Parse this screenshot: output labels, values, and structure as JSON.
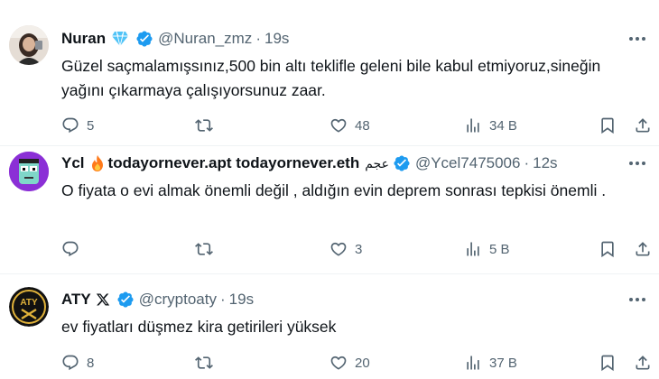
{
  "tweets": [
    {
      "name": "Nuran",
      "handle": "@Nuran_zmz",
      "time": "19s",
      "text": "Güzel saçmalamışsınız,500 bin altı teklifle geleni bile kabul etmiyoruz,sineğin yağını çıkarmaya çalışıyorsunuz zaar.",
      "replies": "5",
      "reposts": "",
      "likes": "48",
      "views": "34 B"
    },
    {
      "name": "Ycl",
      "name_extra": "todayornever.apt todayornever.eth",
      "name_arabic": "عجم",
      "handle": "@Ycel7475006",
      "time": "12s",
      "text": "O fiyata o evi almak önemli değil , aldığın evin deprem sonrası tepkisi önemli .",
      "replies": "",
      "reposts": "",
      "likes": "3",
      "views": "5 B"
    },
    {
      "name": "ATY",
      "handle": "@cryptoaty",
      "time": "19s",
      "text": "ev fiyatları düşmez kira getirileri yüksek",
      "replies": "8",
      "reposts": "",
      "likes": "20",
      "views": "37 B"
    }
  ],
  "avatar_text": "ATY",
  "colors": {
    "verified": "#1d9bf0",
    "muted": "#536471",
    "text": "#0f1419",
    "divider": "#eff3f4",
    "diamond": "#4fc3f7",
    "fire": "#ff7a1a"
  }
}
